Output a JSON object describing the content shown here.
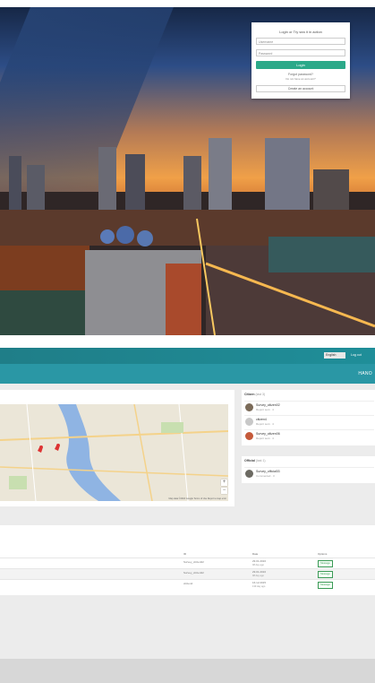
{
  "login": {
    "title": "Login or Try sea it in action",
    "username_placeholder": "Username",
    "password_placeholder": "Password",
    "login_label": "Login",
    "forgot_label": "Forgot password?",
    "no_account_label": "Do not have an account?",
    "create_label": "Create an account"
  },
  "topbar": {
    "language": "English",
    "logout": "Log out"
  },
  "navbar": {
    "city": "HANO"
  },
  "map": {
    "zoom_in": "+",
    "zoom_out": "−",
    "attribution": "Map data ©2016 Google   Terms of Use   Report a map error"
  },
  "citizen_panel": {
    "title": "Citizen",
    "count": "(last 3)",
    "items": [
      {
        "name": "Survey_citizen02",
        "sub": "Report sent · 4"
      },
      {
        "name": "citizen4",
        "sub": "Report sent · 4"
      },
      {
        "name": "Survey_citizen06",
        "sub": "Report sent · 4"
      }
    ]
  },
  "official_panel": {
    "title": "Official",
    "count": "(last 1)",
    "items": [
      {
        "name": "Survey_official03",
        "sub": "Commented · 3"
      }
    ]
  },
  "table": {
    "headers": [
      "ID",
      "Date",
      "Options"
    ],
    "rows": [
      {
        "id": "Survey_citizen02",
        "date": "29.01.2016",
        "ago": "98 day ago",
        "action": "Message"
      },
      {
        "id": "Survey_citizen02",
        "date": "29.01.2016",
        "ago": "98 day ago",
        "action": "Message"
      },
      {
        "id": "citizen4",
        "date": "16.12.2015",
        "ago": "139 day ago",
        "action": "Message"
      }
    ]
  },
  "colors": {
    "accent": "#2ba989",
    "topbar": "#1f7e88",
    "navbar": "#2a97a5"
  }
}
